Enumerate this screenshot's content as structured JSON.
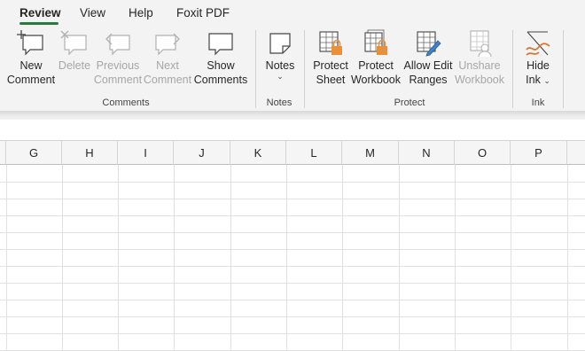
{
  "tabs": [
    {
      "label": "Review",
      "active": true
    },
    {
      "label": "View",
      "active": false
    },
    {
      "label": "Help",
      "active": false
    },
    {
      "label": "Foxit PDF",
      "active": false
    }
  ],
  "ribbon": {
    "comments": {
      "group_label": "Comments",
      "new_comment": {
        "line1": "New",
        "line2": "Comment",
        "icon": "new-comment-icon",
        "enabled": true
      },
      "delete": {
        "line1": "Delete",
        "line2": "",
        "icon": "delete-comment-icon",
        "enabled": false
      },
      "previous_comment": {
        "line1": "Previous",
        "line2": "Comment",
        "icon": "previous-comment-icon",
        "enabled": false
      },
      "next_comment": {
        "line1": "Next",
        "line2": "Comment",
        "icon": "next-comment-icon",
        "enabled": false
      },
      "show_comments": {
        "line1": "Show",
        "line2": "Comments",
        "icon": "show-comments-icon",
        "enabled": true
      }
    },
    "notes": {
      "group_label": "Notes",
      "notes": {
        "line1": "Notes",
        "caret": "⌄",
        "icon": "notes-icon",
        "enabled": true
      }
    },
    "protect": {
      "group_label": "Protect",
      "protect_sheet": {
        "line1": "Protect",
        "line2": "Sheet",
        "icon": "protect-sheet-icon",
        "enabled": true
      },
      "protect_workbook": {
        "line1": "Protect",
        "line2": "Workbook",
        "icon": "protect-workbook-icon",
        "enabled": true
      },
      "allow_edit_ranges": {
        "line1": "Allow Edit",
        "line2": "Ranges",
        "icon": "allow-edit-ranges-icon",
        "enabled": true
      },
      "unshare_workbook": {
        "line1": "Unshare",
        "line2": "Workbook",
        "icon": "unshare-workbook-icon",
        "enabled": false
      }
    },
    "ink": {
      "group_label": "Ink",
      "hide_ink": {
        "line1": "Hide",
        "line2": "Ink",
        "caret": "⌄",
        "icon": "hide-ink-icon",
        "enabled": true
      }
    }
  },
  "grid": {
    "columns": [
      "G",
      "H",
      "I",
      "J",
      "K",
      "L",
      "M",
      "N",
      "O",
      "P"
    ]
  },
  "colors": {
    "accent": "#2b7a3d",
    "lock": "#e8913a",
    "ink_orange": "#e0702a"
  }
}
